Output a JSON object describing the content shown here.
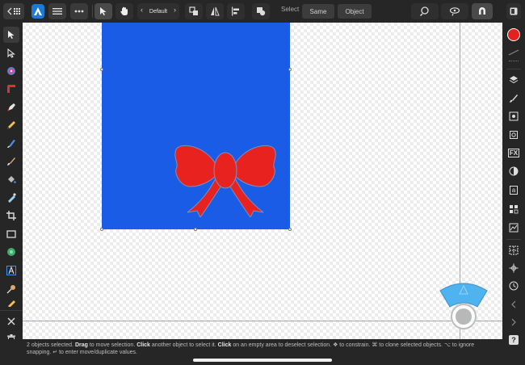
{
  "toolbar": {
    "back_label": "←",
    "persona_icon": "designer-persona-icon",
    "menu_icon": "hamburger-menu-icon",
    "more_icon": "more-icon",
    "tool_modes": [
      "move-tool-icon",
      "hand-tool-icon"
    ],
    "style_picker_label": "Default",
    "select_label": "Select",
    "same_button": "Same",
    "object_button": "Object",
    "color_accent": "#1a5ce6"
  },
  "left_tools": [
    "move-tool-icon",
    "node-tool-icon",
    "radial-tool-icon",
    "corner-tool-icon",
    "pen-tool-icon",
    "pencil-tool-icon",
    "vector-brush-icon",
    "paint-brush-icon",
    "fill-tool-icon",
    "transparency-tool-icon",
    "crop-tool-icon",
    "rectangle-tool-icon",
    "ellipse-shapes-icon",
    "text-tool-icon",
    "color-picker-icon",
    "marker-icon"
  ],
  "right_studios": [
    "color-swatch-red",
    "stroke-icon",
    "layers-icon",
    "brushes-icon",
    "transform-icon",
    "symbols-icon",
    "fx-icon",
    "color-icon",
    "text-styles-icon",
    "swatches-icon",
    "stock-icon",
    "grid-icon",
    "snapping-icon",
    "history-icon",
    "chevron-left-icon",
    "chevron-right-icon",
    "help-icon"
  ],
  "right_labels": {
    "fx": "FX",
    "text_style": "a",
    "help": "?"
  },
  "canvas": {
    "artboard_color": "#1a5ce6",
    "bow_color": "#e8231f",
    "accessory_color": "#4fb3f0"
  },
  "status": {
    "p1": "2 objects selected.",
    "b1": "Drag",
    "p2": "to move selection.",
    "b2": "Click",
    "p3": "another object to select it.",
    "b3": "Click",
    "p4": "on an empty area to deselect selection. ❖ to constrain. ⌘ to clone selected objects. ⌥ to ignore snapping. ↵ to enter move/duplicate values."
  }
}
